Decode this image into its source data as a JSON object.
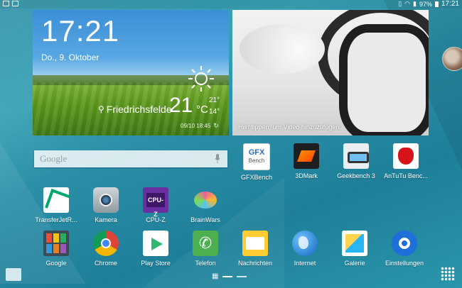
{
  "status_bar": {
    "time": "17:21",
    "battery": "97%"
  },
  "clock_widget": {
    "time": "17:21",
    "date": "Do., 9. Oktober",
    "location": "Friedrichsfelde",
    "temperature": "21",
    "unit": "°C",
    "high": "21°",
    "low": "14°",
    "updated": "09/10 18:45"
  },
  "video_widget": {
    "hint": "Hier tippen, um Video hinzuzufügen."
  },
  "search": {
    "placeholder": "Google"
  },
  "apps": [
    {
      "label": "GFXBench",
      "icon": "gfxbench-icon"
    },
    {
      "label": "3DMark",
      "icon": "3dmark-icon"
    },
    {
      "label": "Geekbench 3",
      "icon": "geekbench-icon"
    },
    {
      "label": "AnTuTu Benc...",
      "icon": "antutu-icon"
    },
    {
      "label": "TransferJetR...",
      "icon": "transferjet-icon"
    },
    {
      "label": "Kamera",
      "icon": "camera-icon"
    },
    {
      "label": "CPU-Z",
      "icon": "cpuz-icon"
    },
    {
      "label": "BrainWars",
      "icon": "brainwars-icon"
    },
    {
      "label": "Google",
      "icon": "google-folder-icon"
    },
    {
      "label": "Chrome",
      "icon": "chrome-icon"
    },
    {
      "label": "Play Store",
      "icon": "play-store-icon"
    },
    {
      "label": "Telefon",
      "icon": "phone-icon"
    },
    {
      "label": "Nachrichten",
      "icon": "messages-icon"
    },
    {
      "label": "Internet",
      "icon": "internet-icon"
    },
    {
      "label": "Galerie",
      "icon": "gallery-icon"
    },
    {
      "label": "Einstellungen",
      "icon": "settings-icon"
    }
  ]
}
